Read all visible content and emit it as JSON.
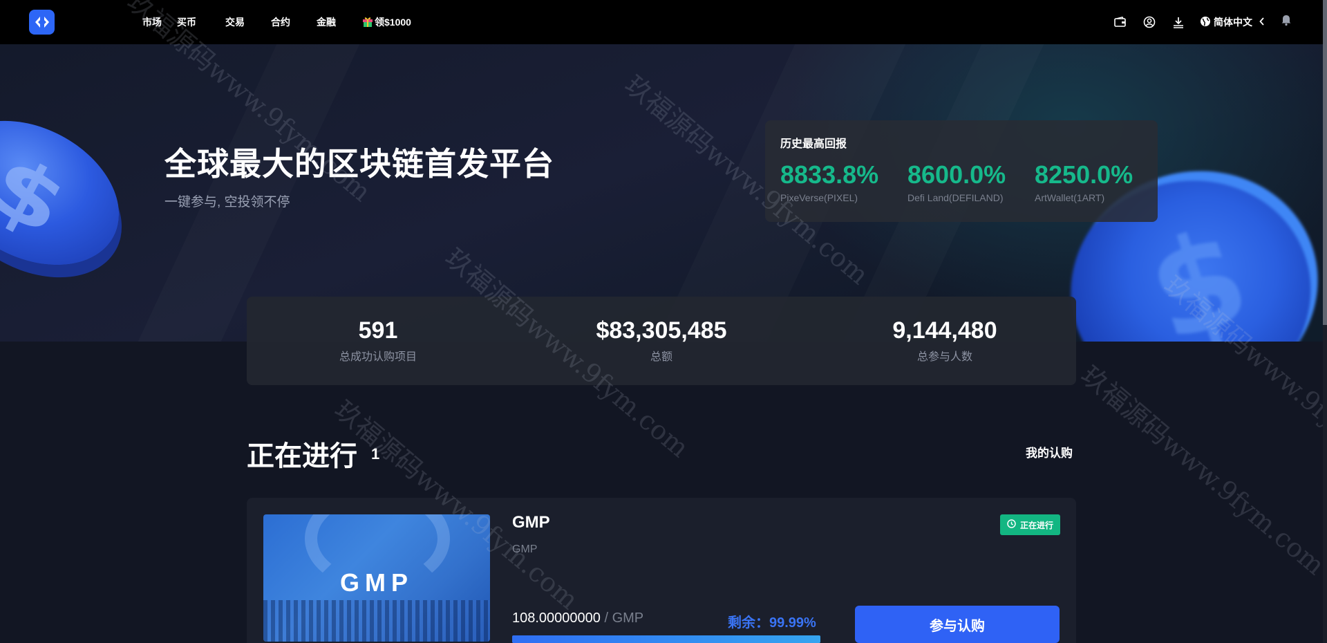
{
  "nav": {
    "items": [
      {
        "label": "市场"
      },
      {
        "label": "买币"
      },
      {
        "label": "交易"
      },
      {
        "label": "合约"
      },
      {
        "label": "金融"
      },
      {
        "label": "领$1000"
      }
    ],
    "language": "简体中文"
  },
  "hero": {
    "title": "全球最大的区块链首发平台",
    "subtitle": "一键参与, 空投领不停"
  },
  "record": {
    "title": "历史最高回报",
    "items": [
      {
        "value": "8833.8%",
        "name": "PixeVerse(PIXEL)"
      },
      {
        "value": "8600.0%",
        "name": "Defi Land(DEFILAND)"
      },
      {
        "value": "8250.0%",
        "name": "ArtWallet(1ART)"
      }
    ]
  },
  "stats": [
    {
      "value": "591",
      "label": "总成功认购项目"
    },
    {
      "value": "$83,305,485",
      "label": "总额"
    },
    {
      "value": "9,144,480",
      "label": "总参与人数"
    }
  ],
  "section": {
    "title": "正在进行",
    "count": "1",
    "my_link": "我的认购"
  },
  "project": {
    "image_text": "GMP",
    "name": "GMP",
    "symbol": "GMP",
    "status": "正在进行",
    "price": "108.00000000",
    "unit": " / GMP",
    "remain": "剩余：99.99%",
    "remain_fraction": 0.9999,
    "button": "参与认购"
  },
  "watermark": "玖福源码www.9fym.com",
  "colors": {
    "accent": "#2f62f5",
    "positive": "#16b98b",
    "status_green": "#13b682"
  }
}
